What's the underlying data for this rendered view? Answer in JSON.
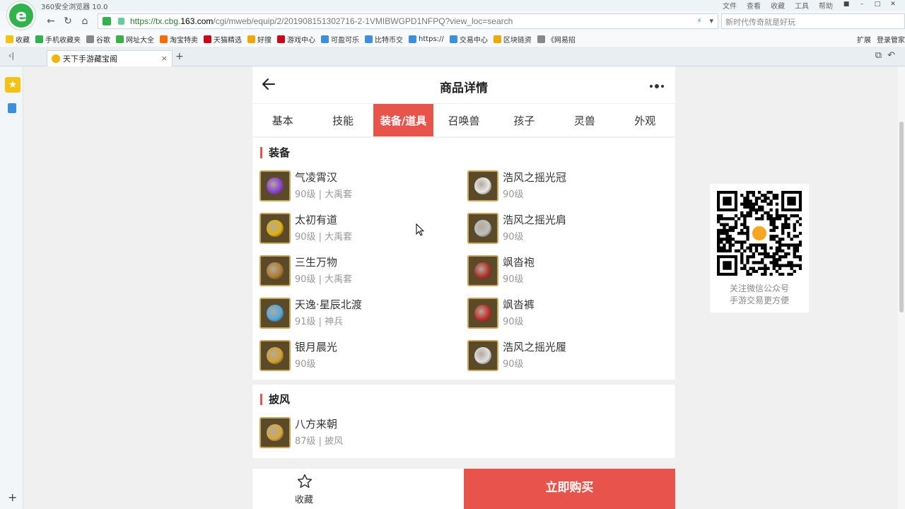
{
  "browser": {
    "window_title": "360安全浏览器 10.0",
    "menus": [
      "文件",
      "查看",
      "收藏",
      "工具",
      "帮助"
    ],
    "url_prefix": "https://tx.cbg.",
    "url_domain": "163.com",
    "url_rest": "/cgi/mweb/equip/2/201908151302716-2-1VMIBWGPD1NFPQ?view_loc=search",
    "search_placeholder": "新时代传奇就是好玩",
    "bookmarks": [
      {
        "label": "收藏",
        "color": "#f5c211"
      },
      {
        "label": "手机收藏夹",
        "color": "#2fb34a"
      },
      {
        "label": "谷歌",
        "color": "#888888"
      },
      {
        "label": "网址大全",
        "color": "#3cb043"
      },
      {
        "label": "淘宝特卖",
        "color": "#ff6a00"
      },
      {
        "label": "天猫精选",
        "color": "#d0021b"
      },
      {
        "label": "好搜",
        "color": "#f0a800"
      },
      {
        "label": "游戏中心",
        "color": "#d0021b"
      },
      {
        "label": "可盈可乐",
        "color": "#3b8fe0"
      },
      {
        "label": "比特币交",
        "color": "#3b8fe0"
      },
      {
        "label": "https://",
        "color": "#3b8fe0"
      },
      {
        "label": "交易中心",
        "color": "#3b8fe0"
      },
      {
        "label": "区块链资",
        "color": "#f0a800"
      },
      {
        "label": "《网易招",
        "color": "#888888"
      }
    ],
    "bookmarks_right": [
      "扩展",
      "登录管家"
    ],
    "tab_title": "天下手游藏宝阁"
  },
  "page": {
    "title": "商品详情",
    "tabs": [
      "基本",
      "技能",
      "装备/道具",
      "召唤兽",
      "孩子",
      "灵兽",
      "外观"
    ],
    "active_tab_index": 2,
    "equipment_title": "装备",
    "equipment_left": [
      {
        "name": "气凌霄汉",
        "sub": "90级 | 大禹套",
        "gem": "#8a3fd1"
      },
      {
        "name": "太初有道",
        "sub": "90级 | 大禹套",
        "gem": "#e0b010"
      },
      {
        "name": "三生万物",
        "sub": "90级 | 大禹套",
        "gem": "#b07a30"
      },
      {
        "name": "天逸·星辰北渡",
        "sub": "91级 | 神兵",
        "gem": "#4fa8e0"
      },
      {
        "name": "银月晨光",
        "sub": "90级",
        "gem": "#d2a030"
      }
    ],
    "equipment_right": [
      {
        "name": "浩风之摇光冠",
        "sub": "90级",
        "gem": "#e8e8e8"
      },
      {
        "name": "浩风之摇光肩",
        "sub": "90级",
        "gem": "#c0c0c0"
      },
      {
        "name": "飒沓袍",
        "sub": "90级",
        "gem": "#b0302a"
      },
      {
        "name": "飒沓裤",
        "sub": "90级",
        "gem": "#c0302a"
      },
      {
        "name": "浩风之摇光履",
        "sub": "90级",
        "gem": "#e0e0e0"
      }
    ],
    "cape_title": "披风",
    "cape_items": [
      {
        "name": "八方来朝",
        "sub": "87级 | 披风",
        "gem": "#d8a840"
      }
    ],
    "fav_label": "收藏",
    "buy_label": "立即购买",
    "qr_line1": "关注微信公众号",
    "qr_line2": "手游交易更方便"
  },
  "colors": {
    "accent": "#e8534b",
    "item_border": "#c9a65a"
  }
}
